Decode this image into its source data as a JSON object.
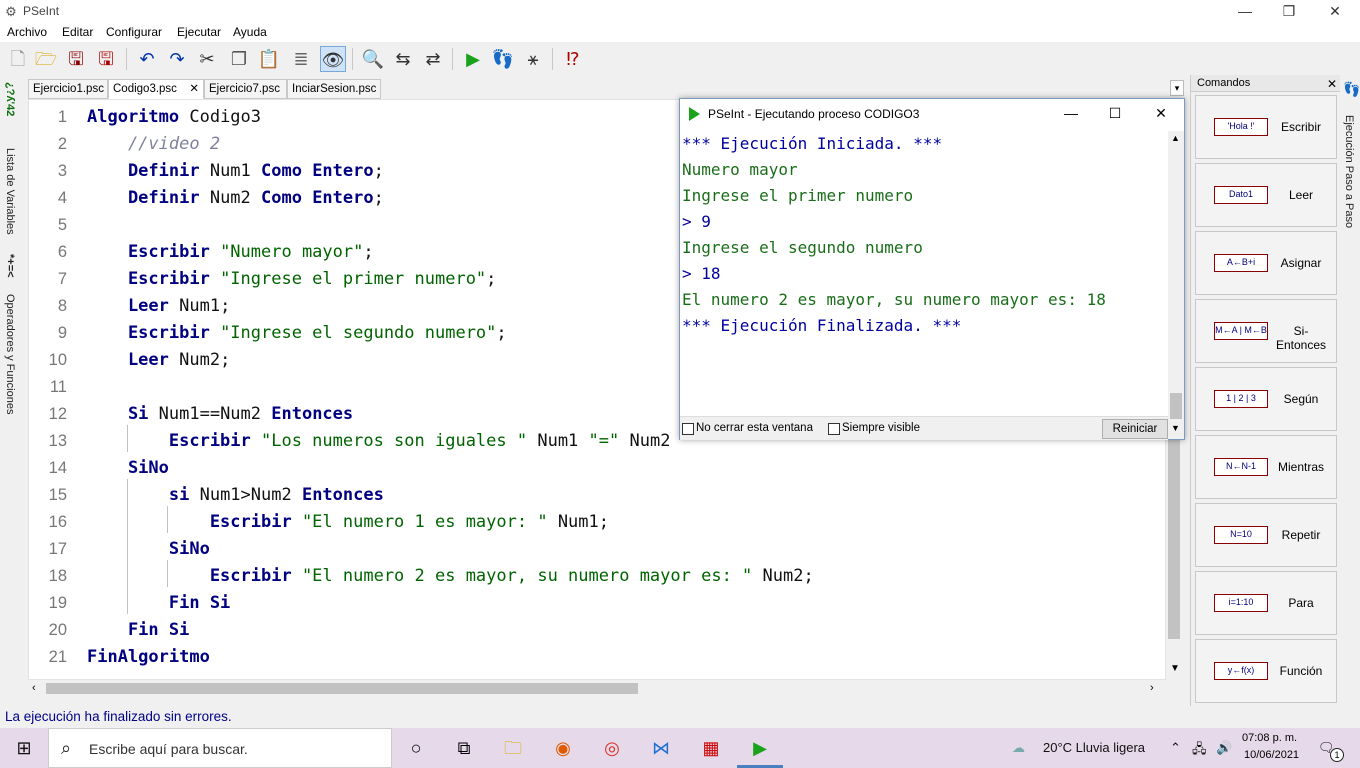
{
  "window": {
    "title": "PSeInt",
    "minimize": "—",
    "maximize": "❐",
    "close": "✕"
  },
  "menu": [
    "Archivo",
    "Editar",
    "Configurar",
    "Ejecutar",
    "Ayuda"
  ],
  "tabs": [
    {
      "label": "Ejercicio1.psc"
    },
    {
      "label": "Codigo3.psc",
      "close": "✕"
    },
    {
      "label": "Ejercicio7.psc"
    },
    {
      "label": "InciarSesion.psc"
    }
  ],
  "side_left": {
    "variables": "Lista de Variables",
    "operators": "Operadores y Funciones",
    "vars_glyph": "*+=<",
    "ops_glyph": "¿?ʎ'42"
  },
  "side_right": {
    "step": "Ejecución Paso a Paso"
  },
  "code": [
    {
      "n": "1",
      "parts": [
        {
          "c": "kw",
          "t": "Algoritmo"
        },
        {
          "c": "id",
          "t": " Codigo3"
        }
      ]
    },
    {
      "n": "2",
      "parts": [
        {
          "c": "cm",
          "t": "    //video 2"
        }
      ]
    },
    {
      "n": "3",
      "parts": [
        {
          "c": "kw",
          "t": "    Definir"
        },
        {
          "c": "id",
          "t": " Num1 "
        },
        {
          "c": "kw",
          "t": "Como Entero"
        },
        {
          "c": "id",
          "t": ";"
        }
      ]
    },
    {
      "n": "4",
      "parts": [
        {
          "c": "kw",
          "t": "    Definir"
        },
        {
          "c": "id",
          "t": " Num2 "
        },
        {
          "c": "kw",
          "t": "Como Entero"
        },
        {
          "c": "id",
          "t": ";"
        }
      ]
    },
    {
      "n": "5",
      "parts": []
    },
    {
      "n": "6",
      "parts": [
        {
          "c": "kw",
          "t": "    Escribir"
        },
        {
          "c": "str",
          "t": " \"Numero mayor\""
        },
        {
          "c": "id",
          "t": ";"
        }
      ]
    },
    {
      "n": "7",
      "parts": [
        {
          "c": "kw",
          "t": "    Escribir"
        },
        {
          "c": "str",
          "t": " \"Ingrese el primer numero\""
        },
        {
          "c": "id",
          "t": ";"
        }
      ]
    },
    {
      "n": "8",
      "parts": [
        {
          "c": "kw",
          "t": "    Leer"
        },
        {
          "c": "id",
          "t": " Num1;"
        }
      ]
    },
    {
      "n": "9",
      "parts": [
        {
          "c": "kw",
          "t": "    Escribir"
        },
        {
          "c": "str",
          "t": " \"Ingrese el segundo numero\""
        },
        {
          "c": "id",
          "t": ";"
        }
      ]
    },
    {
      "n": "10",
      "parts": [
        {
          "c": "kw",
          "t": "    Leer"
        },
        {
          "c": "id",
          "t": " Num2;"
        }
      ]
    },
    {
      "n": "11",
      "parts": []
    },
    {
      "n": "12",
      "parts": [
        {
          "c": "kw",
          "t": "    Si"
        },
        {
          "c": "id",
          "t": " Num1==Num2 "
        },
        {
          "c": "kw",
          "t": "Entonces"
        }
      ]
    },
    {
      "n": "13",
      "parts": [
        {
          "c": "kw",
          "t": "        Escribir"
        },
        {
          "c": "str",
          "t": " \"Los numeros son iguales \""
        },
        {
          "c": "id",
          "t": " Num1 "
        },
        {
          "c": "str",
          "t": "\"=\""
        },
        {
          "c": "id",
          "t": " Num2"
        }
      ]
    },
    {
      "n": "14",
      "parts": [
        {
          "c": "kw",
          "t": "    SiNo"
        }
      ]
    },
    {
      "n": "15",
      "parts": [
        {
          "c": "kw",
          "t": "        si"
        },
        {
          "c": "id",
          "t": " Num1>Num2 "
        },
        {
          "c": "kw",
          "t": "Entonces"
        }
      ]
    },
    {
      "n": "16",
      "parts": [
        {
          "c": "kw",
          "t": "            Escribir"
        },
        {
          "c": "str",
          "t": " \"El numero 1 es mayor: \""
        },
        {
          "c": "id",
          "t": " Num1;"
        }
      ]
    },
    {
      "n": "17",
      "parts": [
        {
          "c": "kw",
          "t": "        SiNo"
        }
      ]
    },
    {
      "n": "18",
      "parts": [
        {
          "c": "kw",
          "t": "            Escribir"
        },
        {
          "c": "str",
          "t": " \"El numero 2 es mayor, su numero mayor es: \""
        },
        {
          "c": "id",
          "t": " Num2;"
        }
      ]
    },
    {
      "n": "19",
      "parts": [
        {
          "c": "kw",
          "t": "        Fin Si"
        }
      ]
    },
    {
      "n": "20",
      "parts": [
        {
          "c": "kw",
          "t": "    Fin Si"
        }
      ]
    },
    {
      "n": "21",
      "parts": [
        {
          "c": "kw",
          "t": "FinAlgoritmo"
        }
      ]
    }
  ],
  "commands": {
    "header": "Comandos",
    "close": "✕",
    "items": [
      {
        "label": "Escribir",
        "sym": "'Hola !'"
      },
      {
        "label": "Leer",
        "sym": "Dato1"
      },
      {
        "label": "Asignar",
        "sym": "A←B+i"
      },
      {
        "label": "Si-Entonces",
        "sym": "M←A | M←B"
      },
      {
        "label": "Según",
        "sym": "1 | 2 | 3"
      },
      {
        "label": "Mientras",
        "sym": "N←N-1"
      },
      {
        "label": "Repetir",
        "sym": "N=10"
      },
      {
        "label": "Para",
        "sym": "i=1:10"
      },
      {
        "label": "Función",
        "sym": "y←f(x)"
      }
    ]
  },
  "exec": {
    "title": "PSeInt - Ejecutando proceso CODIGO3",
    "minimize": "—",
    "maximize": "☐",
    "close": "✕",
    "lines": [
      {
        "c": "blue",
        "t": "*** Ejecución Iniciada. ***"
      },
      {
        "c": "green",
        "t": "Numero mayor"
      },
      {
        "c": "green",
        "t": "Ingrese el primer numero"
      },
      {
        "c": "blue",
        "t": "> 9"
      },
      {
        "c": "green",
        "t": "Ingrese el segundo numero"
      },
      {
        "c": "blue",
        "t": "> 18"
      },
      {
        "c": "green",
        "t": "El numero 2 es mayor, su numero mayor es: 18"
      },
      {
        "c": "blue",
        "t": "*** Ejecución Finalizada. ***"
      }
    ],
    "no_cerrar": "No cerrar esta ventana",
    "siempre_visible": "Siempre visible",
    "reiniciar": "Reiniciar"
  },
  "status": "La ejecución ha finalizado sin errores.",
  "taskbar": {
    "search_placeholder": "Escribe aquí para buscar.",
    "weather": "20°C  Lluvia ligera",
    "time": "07:08 p. m.",
    "date": "10/06/2021",
    "notif_count": "1"
  }
}
